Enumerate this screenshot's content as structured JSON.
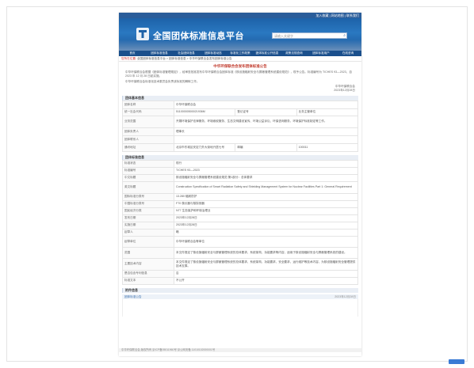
{
  "header": {
    "top_links": "加入收藏 | 网站地图 | 联系我们",
    "site_title": "全国团体标准信息平台",
    "search_placeholder": "请输入关键字"
  },
  "nav": [
    "首页",
    "团体标准信息",
    "社会团体信息",
    "团体标准动态",
    "标准化工作政策",
    "团体标准公开信息",
    "政策法规查询",
    "团体标准用户",
    "在线咨询"
  ],
  "breadcrumb": {
    "label": "您所在位置:",
    "path": "全国团体标准信息平台 > 团体标准信息 > 中华环保联合会发布团体标准公告"
  },
  "notice": {
    "title": "中华环保联合会发布团体标准公告",
    "paragraph1": "中华环保联合会根据《团体标准管理规定》，经审查批准发布中华环保联合会团体标准《核设施辐射安全与屏蔽管理系统建设规范》，现予公告。标准编号为 T/CHES 93—2023，自 2023 年 12 月 28 日起实施。",
    "paragraph2": "中华环保联合会标准化技术委员会负责该标准的解释工作。",
    "sign_org": "中华环保联合会",
    "sign_date": "2023年12月28日"
  },
  "org_section": {
    "title": "团体基本信息",
    "rows": [
      {
        "k": "团体名称",
        "v": "中华环保联合会"
      },
      {
        "k": "统一社会代码",
        "v": "51100000500021936M",
        "k2": "登记证号",
        "v2": "业务主管单位"
      },
      {
        "k": "业务范围",
        "v": "开展环境保护法律服务、环境维权服务、生态文明建设宣传、环境公益诉讼、环保咨询服务、环境保护标准制定等工作。"
      },
      {
        "k": "团体负责人",
        "v": "理事长"
      },
      {
        "k": "团体联系人",
        "v": ""
      },
      {
        "k": "通讯地址",
        "v": "北京市东城区安定门外大街地兴居七号",
        "k2": "邮编",
        "v2": "100011"
      }
    ]
  },
  "std_section": {
    "title": "团体标准信息",
    "rows": [
      {
        "k": "标准状态",
        "v": "现行"
      },
      {
        "k": "标准编号",
        "v": "T/CHES 93—2023"
      },
      {
        "k": "中文标题",
        "v": "核设施辐射安全与屏蔽管理系统建设规范 第1部分：总体要求"
      },
      {
        "k": "英文标题",
        "v": "Construction Specification of Smart Radiation Safety and Shielding Management System for Nuclear Facilities Part 1: General Requirement"
      },
      {
        "k": "国际标准分类号",
        "v": "13.280 辐射防护"
      },
      {
        "k": "中国标准分类号",
        "v": "F70 核仪器与核探测器"
      },
      {
        "k": "国民经济分类",
        "v": "N77 生态保护和环境治理业"
      },
      {
        "k": "发布日期",
        "v": "2023年12月28日"
      },
      {
        "k": "实施日期",
        "v": "2023年12月28日"
      },
      {
        "k": "起草人",
        "v": "略"
      },
      {
        "k": "起草单位",
        "v": "中华环保联合会等单位"
      },
      {
        "k": "范围",
        "v": "本文件规定了核设施辐射安全与屏蔽管理系统的总体要求、系统架构、功能要求等内容，适用于核设施辐射安全与屏蔽管理系统的建设。"
      },
      {
        "k": "主要技术内容",
        "v": "本文件规定了核设施辐射安全与屏蔽管理系统的总体要求、系统架构、功能要求、安全要求、运行维护等技术内容，为核设施辐射安全管理提供技术支撑。"
      },
      {
        "k": "是否包含专利信息",
        "v": "否"
      },
      {
        "k": "标准文本",
        "v": "不公开"
      }
    ]
  },
  "attach_section": {
    "title": "附件信息",
    "item": "团体标准公告",
    "date": "2023年12月28日"
  },
  "footer": {
    "text": "中华环保联合会  版权所有  京ICP备05011960号  京公网安备 11010102000001号"
  }
}
